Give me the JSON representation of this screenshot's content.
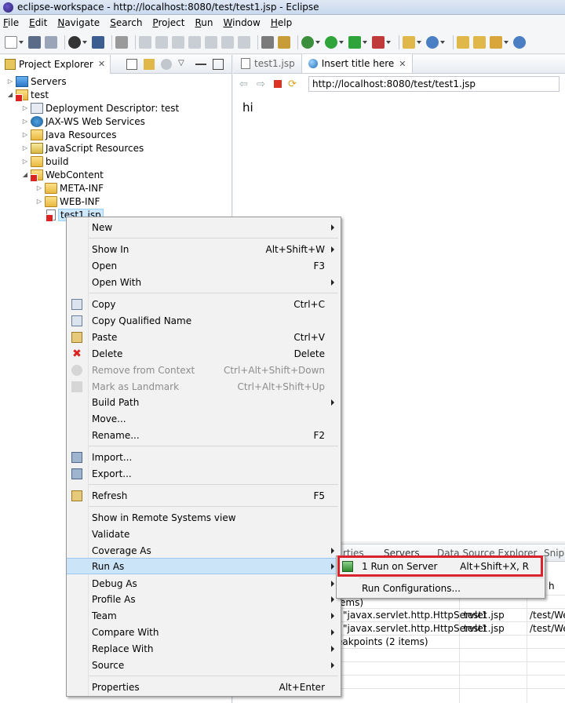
{
  "window": {
    "title": "eclipse-workspace - http://localhost:8080/test/test1.jsp - Eclipse"
  },
  "menubar": [
    "File",
    "Edit",
    "Navigate",
    "Search",
    "Project",
    "Run",
    "Window",
    "Help"
  ],
  "project_explorer": {
    "tab_label": "Project Explorer",
    "tree": [
      {
        "label": "Servers",
        "icon": "servers-folder-icon"
      },
      {
        "label": "test",
        "icon": "web-project-icon"
      },
      {
        "label": "Deployment Descriptor: test",
        "icon": "deployment-descriptor-icon"
      },
      {
        "label": "JAX-WS Web Services",
        "icon": "web-services-icon"
      },
      {
        "label": "Java Resources",
        "icon": "java-resources-icon"
      },
      {
        "label": "JavaScript Resources",
        "icon": "javascript-resources-icon"
      },
      {
        "label": "build",
        "icon": "folder-icon"
      },
      {
        "label": "WebContent",
        "icon": "webcontent-folder-icon"
      },
      {
        "label": "META-INF",
        "icon": "folder-icon"
      },
      {
        "label": "WEB-INF",
        "icon": "folder-icon"
      },
      {
        "label": "test1.jsp",
        "icon": "jsp-file-icon"
      }
    ]
  },
  "editor": {
    "tabs": [
      {
        "label": "test1.jsp",
        "active": false
      },
      {
        "label": "Insert title here",
        "active": true
      }
    ],
    "url": "http://localhost:8080/test/test1.jsp",
    "content": "hi"
  },
  "bottom_panel": {
    "tabs": [
      "rties",
      "Servers",
      "Data Source Explorer",
      "Snipp"
    ],
    "header_fragment": "h",
    "rows": [
      {
        "col1": "ems)",
        "col2": "",
        "col3": ""
      },
      {
        "col1": "\"javax.servlet.http.HttpServlet",
        "col2": "test1.jsp",
        "col3": "/test/We"
      },
      {
        "col1": "\"javax.servlet.http.HttpServlet",
        "col2": "test1.jsp",
        "col3": "/test/We"
      },
      {
        "col1": "eakpoints (2 items)",
        "col2": "",
        "col3": ""
      }
    ]
  },
  "context_menu": {
    "items": [
      {
        "label": "New",
        "shortcut": "",
        "submenu": true
      },
      {
        "label": "Show In",
        "shortcut": "Alt+Shift+W",
        "submenu": true
      },
      {
        "label": "Open",
        "shortcut": "F3"
      },
      {
        "label": "Open With",
        "shortcut": "",
        "submenu": true
      },
      {
        "label": "Copy",
        "shortcut": "Ctrl+C",
        "icon": "copy-icon"
      },
      {
        "label": "Copy Qualified Name",
        "shortcut": "",
        "icon": "copy-qualified-icon"
      },
      {
        "label": "Paste",
        "shortcut": "Ctrl+V",
        "icon": "paste-icon"
      },
      {
        "label": "Delete",
        "shortcut": "Delete",
        "icon": "delete-icon"
      },
      {
        "label": "Remove from Context",
        "shortcut": "Ctrl+Alt+Shift+Down",
        "disabled": true,
        "icon": "remove-context-icon"
      },
      {
        "label": "Mark as Landmark",
        "shortcut": "Ctrl+Alt+Shift+Up",
        "disabled": true,
        "icon": "landmark-icon"
      },
      {
        "label": "Build Path",
        "shortcut": "",
        "submenu": true
      },
      {
        "label": "Move...",
        "shortcut": ""
      },
      {
        "label": "Rename...",
        "shortcut": "F2"
      },
      {
        "label": "Import...",
        "shortcut": "",
        "icon": "import-icon"
      },
      {
        "label": "Export...",
        "shortcut": "",
        "icon": "export-icon"
      },
      {
        "label": "Refresh",
        "shortcut": "F5",
        "icon": "refresh-icon"
      },
      {
        "label": "Show in Remote Systems view",
        "shortcut": ""
      },
      {
        "label": "Validate",
        "shortcut": ""
      },
      {
        "label": "Coverage As",
        "shortcut": "",
        "submenu": true
      },
      {
        "label": "Run As",
        "shortcut": "",
        "submenu": true,
        "highlighted": true
      },
      {
        "label": "Debug As",
        "shortcut": "",
        "submenu": true
      },
      {
        "label": "Profile As",
        "shortcut": "",
        "submenu": true
      },
      {
        "label": "Team",
        "shortcut": "",
        "submenu": true
      },
      {
        "label": "Compare With",
        "shortcut": "",
        "submenu": true
      },
      {
        "label": "Replace With",
        "shortcut": "",
        "submenu": true
      },
      {
        "label": "Source",
        "shortcut": "",
        "submenu": true
      },
      {
        "label": "Properties",
        "shortcut": "Alt+Enter"
      }
    ]
  },
  "run_as_submenu": {
    "items": [
      {
        "label": "1 Run on Server",
        "shortcut": "Alt+Shift+X, R",
        "icon": "run-on-server-icon"
      },
      {
        "label": "Run Configurations...",
        "shortcut": ""
      }
    ]
  },
  "colors": {
    "highlight_box": "#d9232d",
    "menu_hover": "#cce4f7"
  }
}
